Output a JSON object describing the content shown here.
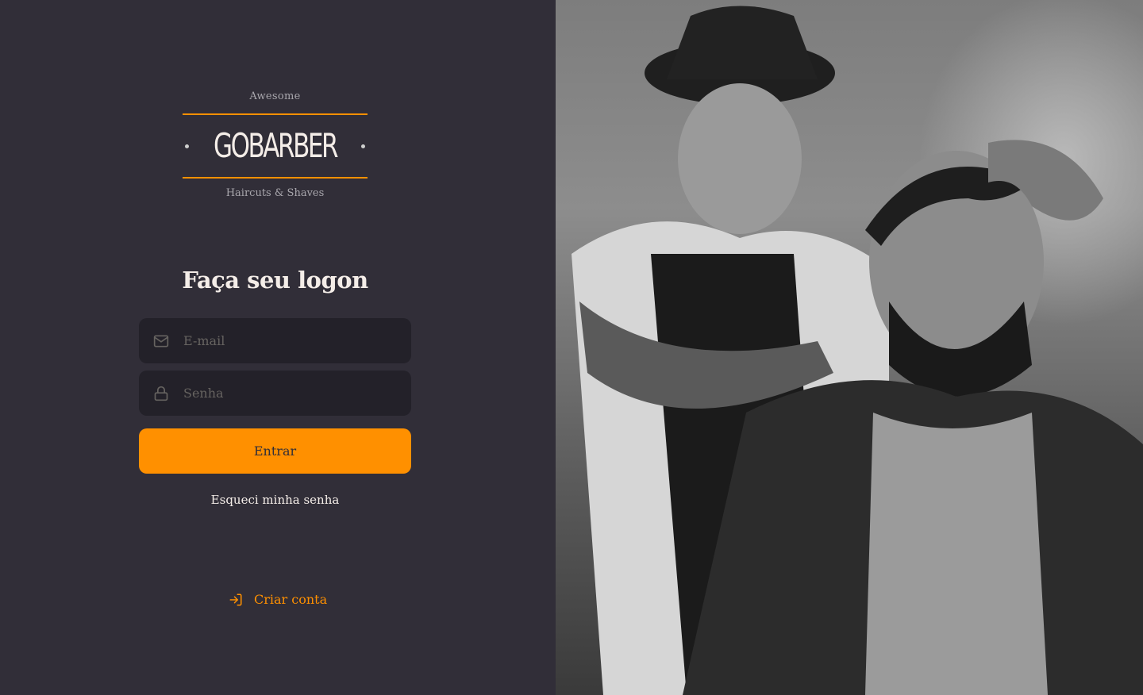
{
  "logo": {
    "top_text": "Awesome",
    "name": "GOBARBER",
    "sub_text": "Haircuts & Shaves"
  },
  "form": {
    "title": "Faça seu logon",
    "email_placeholder": "E-mail",
    "password_placeholder": "Senha",
    "submit_label": "Entrar",
    "forgot_label": "Esqueci minha senha"
  },
  "signup": {
    "label": "Criar conta"
  },
  "colors": {
    "background": "#312e38",
    "input_bg": "#232129",
    "accent": "#ff9000",
    "text": "#f4ede8",
    "placeholder": "#666360"
  },
  "icons": {
    "email": "mail-icon",
    "password": "lock-icon",
    "signup": "log-in-icon"
  },
  "image": {
    "description_name": "barber-photo"
  }
}
